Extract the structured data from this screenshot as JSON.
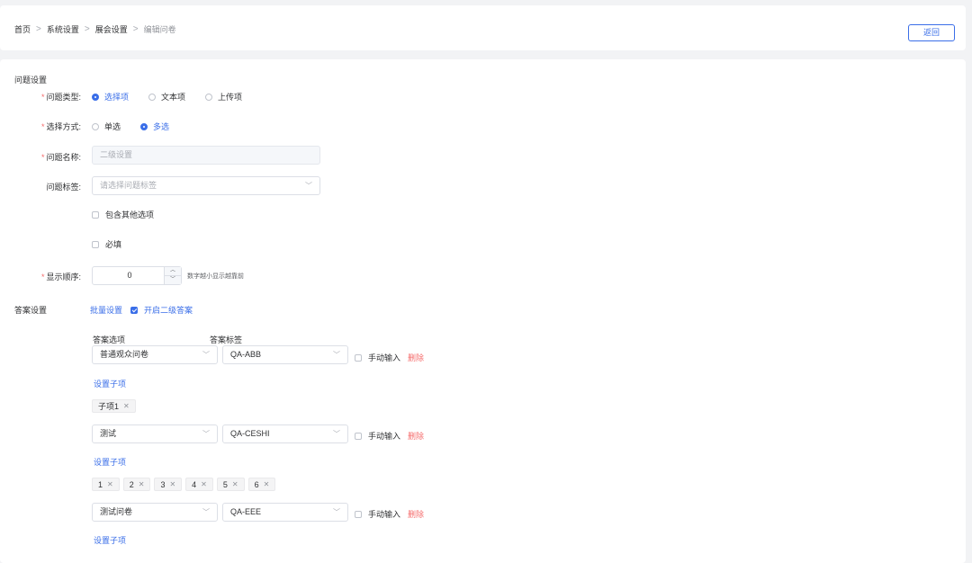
{
  "breadcrumb": {
    "items": [
      "首页",
      "系统设置",
      "展会设置"
    ],
    "current": "编辑问卷",
    "separator": ">"
  },
  "header": {
    "back_label": "返回"
  },
  "question_settings": {
    "section_title": "问题设置",
    "type": {
      "label": "问题类型:",
      "options": [
        "选择项",
        "文本项",
        "上传项"
      ],
      "selected": "选择项"
    },
    "select_mode": {
      "label": "选择方式:",
      "options": [
        "单选",
        "多选"
      ],
      "selected": "多选"
    },
    "name": {
      "label": "问题名称:",
      "value": "二级设置"
    },
    "tag": {
      "label": "问题标签:",
      "placeholder": "请选择问题标签"
    },
    "include_other": {
      "label": "包含其他选项",
      "checked": false
    },
    "required": {
      "label": "必填",
      "checked": false
    },
    "order": {
      "label": "显示顺序:",
      "value": "0",
      "hint": "数字越小显示越靠前"
    }
  },
  "answer_settings": {
    "section_title": "答案设置",
    "batch_label": "批量设置",
    "second_level": {
      "label": "开启二级答案",
      "checked": true
    },
    "col_option": "答案选项",
    "col_tag": "答案标签",
    "manual_input_label": "手动输入",
    "delete_label": "删除",
    "set_children_label": "设置子项",
    "rows": [
      {
        "option": "普通观众问卷",
        "tag": "QA-ABB",
        "children": [
          "子项1"
        ]
      },
      {
        "option": "测试",
        "tag": "QA-CESHI",
        "children": [
          "1",
          "2",
          "3",
          "4",
          "5",
          "6"
        ]
      },
      {
        "option": "测试问卷",
        "tag": "QA-EEE",
        "children": []
      }
    ]
  },
  "icons": {
    "chevron": "chevron-down-icon",
    "tag_close": "close-icon",
    "stepper_up": "caret-up-icon",
    "stepper_down": "caret-down-icon"
  },
  "colors": {
    "primary": "#3a6ee8",
    "danger": "#f56c6c",
    "required": "#f56c6c"
  }
}
